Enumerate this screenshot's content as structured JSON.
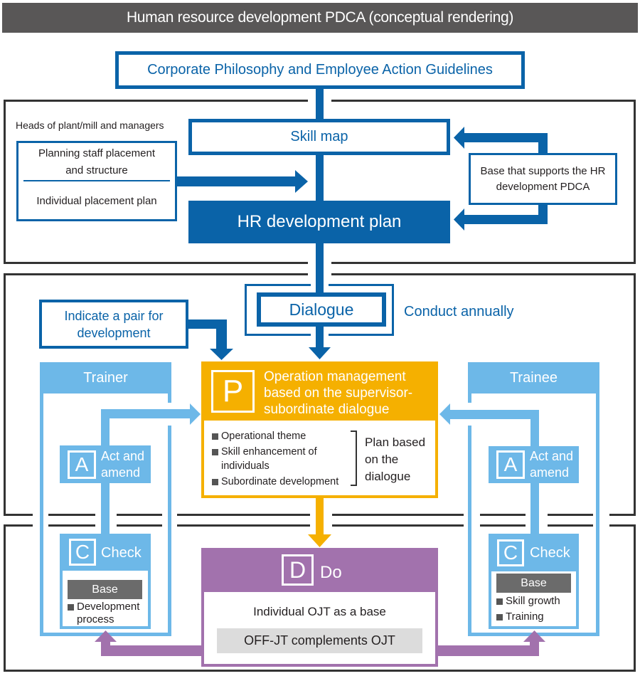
{
  "colors": {
    "dark_blue": "#0a63a8",
    "light_blue": "#6db8e8",
    "orange": "#f5b000",
    "purple": "#a272ad",
    "title_bar": "#595757",
    "base_bar": "#6b6b6b",
    "offjt_bg": "#dcdcdc",
    "frame": "#333333",
    "text": "#231f20",
    "bullet": "#555555"
  },
  "title": "Human resource development PDCA (conceptual rendering)",
  "philosophy": "Corporate Philosophy and Employee Action Guidelines",
  "management": {
    "label": "Heads of plant/mill and managers",
    "placement_box": {
      "top": "Planning staff placement and structure",
      "bottom": "Individual placement plan"
    },
    "skill_map": "Skill map",
    "hr_plan": "HR development plan",
    "support_base": "Base that supports the HR development PDCA"
  },
  "dialogue": {
    "pair_box": "Indicate a pair for development",
    "label": "Dialogue",
    "frequency": "Conduct annually"
  },
  "trainer": {
    "title": "Trainer",
    "act": {
      "letter": "A",
      "label": "Act and amend"
    },
    "check": {
      "letter": "C",
      "label": "Check",
      "base_label": "Base",
      "items": [
        "Development process"
      ]
    }
  },
  "trainee": {
    "title": "Trainee",
    "act": {
      "letter": "A",
      "label": "Act and amend"
    },
    "check": {
      "letter": "C",
      "label": "Check",
      "base_label": "Base",
      "items": [
        "Skill growth",
        "Training"
      ]
    }
  },
  "plan": {
    "letter": "P",
    "title": "Operation management based on the supervisor-subordinate dialogue",
    "items": [
      "Operational theme",
      "Skill enhancement of individuals",
      "Subordinate development"
    ],
    "summary": "Plan based on the dialogue"
  },
  "do": {
    "letter": "D",
    "title": "Do",
    "main": "Individual OJT as a base",
    "complement": "OFF-JT complements OJT"
  }
}
